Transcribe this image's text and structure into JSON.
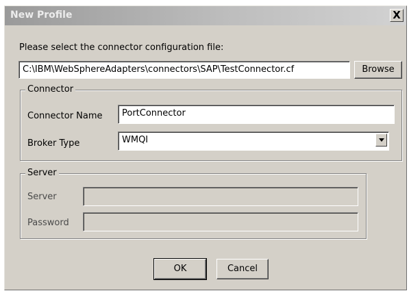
{
  "dialog": {
    "title": "New Profile",
    "close_glyph": "X"
  },
  "config_file": {
    "prompt": "Please select the connector configuration file:",
    "path": "C:\\IBM\\WebSphereAdapters\\connectors\\SAP\\TestConnector.cf",
    "browse_label": "Browse"
  },
  "connector": {
    "group_label": "Connector",
    "name_label": "Connector Name",
    "name_value": "PortConnector",
    "broker_label": "Broker Type",
    "broker_value": "WMQI",
    "dropdown_icon": "chevron-down-icon"
  },
  "server": {
    "group_label": "Server",
    "server_label": "Server",
    "server_value": "",
    "password_label": "Password",
    "password_value": ""
  },
  "buttons": {
    "ok_label": "OK",
    "cancel_label": "Cancel"
  }
}
